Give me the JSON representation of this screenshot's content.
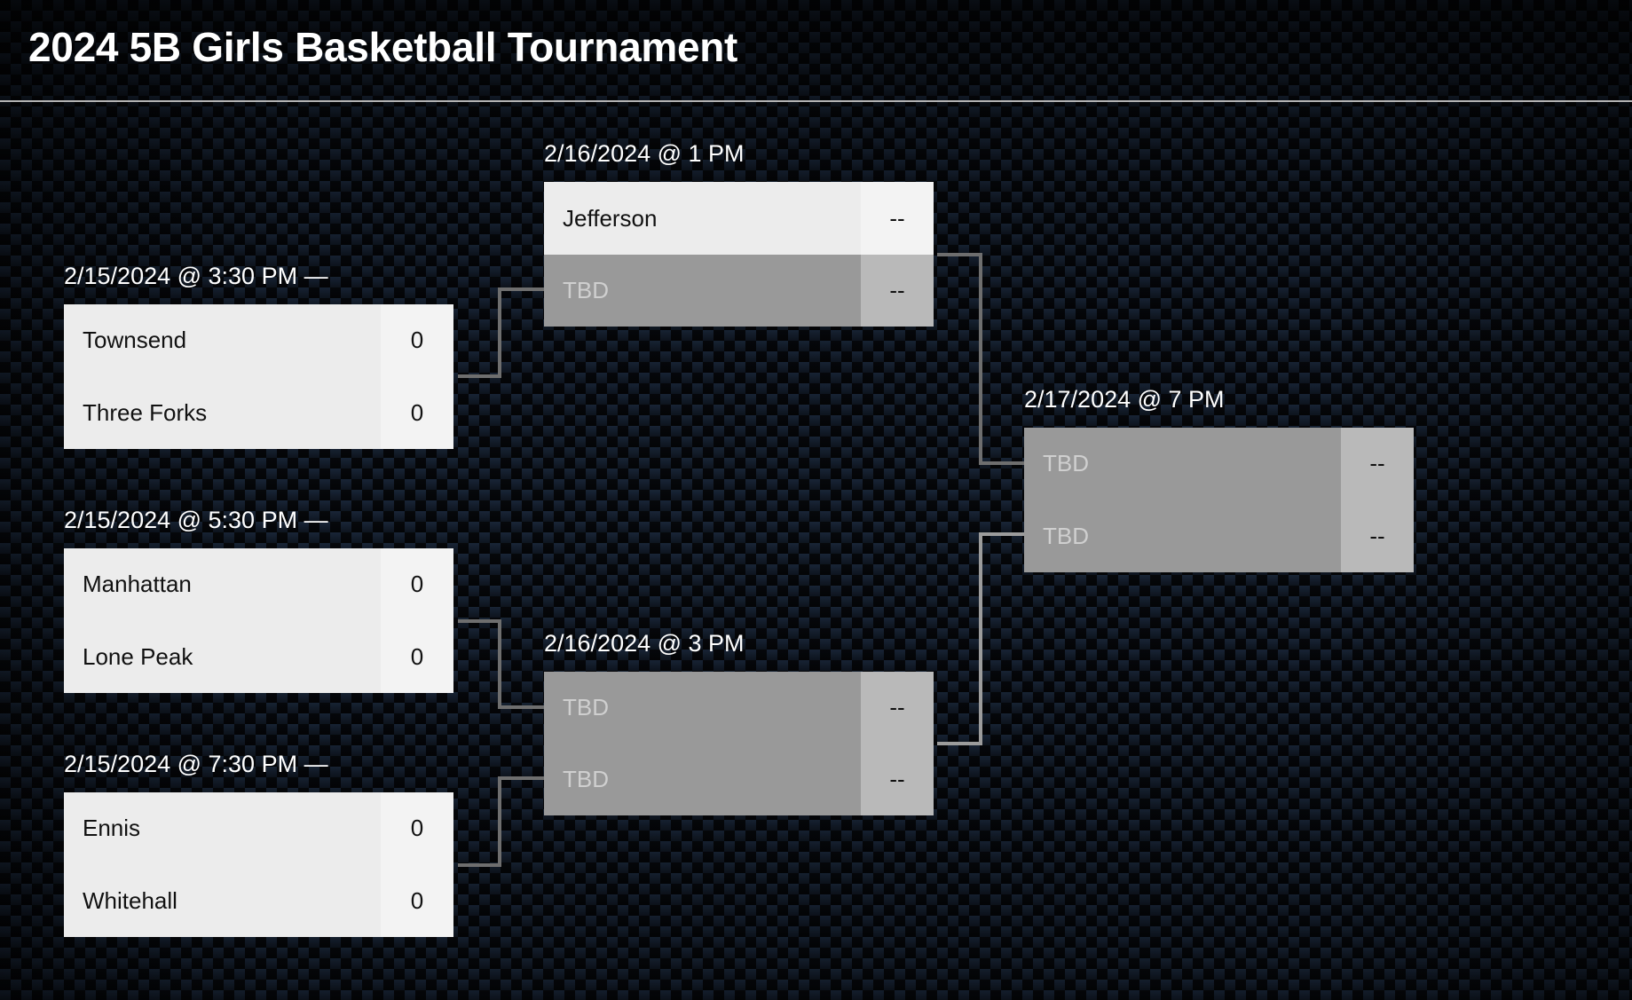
{
  "page": {
    "title": "2024 5B Girls Basketball Tournament"
  },
  "colors": {
    "connector_dark": "#6e6e6e",
    "connector_light": "#9c9c9c",
    "team_cell": "#ececec",
    "score_cell": "#f3f3f3",
    "tbd_team_cell": "#999999",
    "tbd_score_cell": "#b9b9b9"
  },
  "bracket": {
    "round1": [
      {
        "date": "2/15/2024 @ 3:30 PM —",
        "teams": [
          {
            "name": "Townsend",
            "score": "0"
          },
          {
            "name": "Three Forks",
            "score": "0"
          }
        ]
      },
      {
        "date": "2/15/2024 @ 5:30 PM —",
        "teams": [
          {
            "name": "Manhattan",
            "score": "0"
          },
          {
            "name": "Lone Peak",
            "score": "0"
          }
        ]
      },
      {
        "date": "2/15/2024 @ 7:30 PM —",
        "teams": [
          {
            "name": "Ennis",
            "score": "0"
          },
          {
            "name": "Whitehall",
            "score": "0"
          }
        ]
      }
    ],
    "round2": [
      {
        "date": "2/16/2024 @ 1 PM",
        "teams": [
          {
            "name": "Jefferson",
            "score": "--"
          },
          {
            "name": "TBD",
            "score": "--"
          }
        ]
      },
      {
        "date": "2/16/2024 @ 3 PM",
        "teams": [
          {
            "name": "TBD",
            "score": "--"
          },
          {
            "name": "TBD",
            "score": "--"
          }
        ]
      }
    ],
    "final": {
      "date": "2/17/2024 @ 7 PM",
      "teams": [
        {
          "name": "TBD",
          "score": "--"
        },
        {
          "name": "TBD",
          "score": "--"
        }
      ]
    }
  }
}
